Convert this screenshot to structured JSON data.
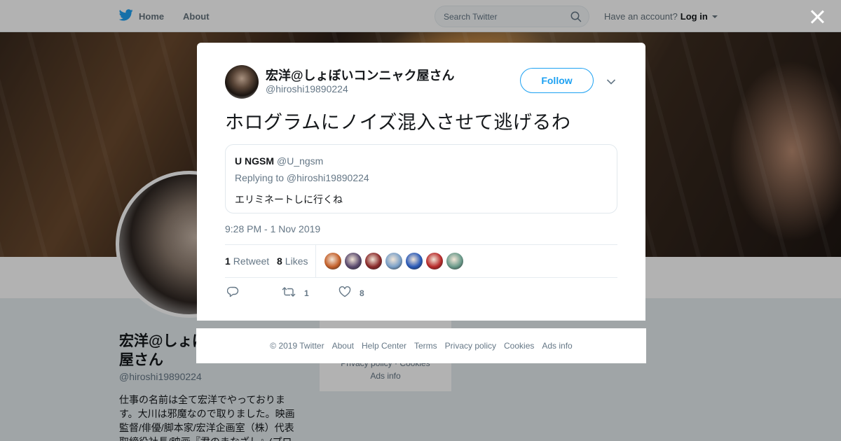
{
  "nav": {
    "home_label": "Home",
    "about_label": "About",
    "search_placeholder": "Search Twitter",
    "have_account": "Have an account?",
    "login_label": "Log in"
  },
  "profile": {
    "name": "宏洋@しょぼいコンニャク屋さん",
    "handle": "@hiroshi19890224",
    "bio": "仕事の名前は全て宏洋でやっております。大川は邪魔なので取りました。映画監督/俳優/脚本家/宏洋企画室（株）代表取締役社長/映画『君のまなざし』(プロ",
    "side_links": [
      "Privacy policy",
      "Cookies",
      "Ads info"
    ]
  },
  "tweet": {
    "author_name": "宏洋@しょぼいコンニャク屋さん",
    "author_handle": "@hiroshi19890224",
    "follow_label": "Follow",
    "text": "ホログラムにノイズ混入させて逃げるわ",
    "quote": {
      "name": "U NGSM",
      "handle": "@U_ngsm",
      "replying_to": "Replying to @hiroshi19890224",
      "text": "エリミネートしに行くね"
    },
    "timestamp": "9:28 PM - 1 Nov 2019",
    "retweet_count": "1",
    "retweet_label": "Retweet",
    "like_count": "8",
    "like_label": "Likes",
    "likers": [
      "#c4602a",
      "#5a4a6e",
      "#8a2a2a",
      "#7aa0c8",
      "#2a5ab8",
      "#b82a2a",
      "#6a9a8a"
    ],
    "action_retweet_count": "1",
    "action_like_count": "8"
  },
  "footer": {
    "links": [
      "© 2019 Twitter",
      "About",
      "Help Center",
      "Terms",
      "Privacy policy",
      "Cookies",
      "Ads info"
    ]
  },
  "colors": {
    "accent": "#1da1f2",
    "secondary_text": "#657786"
  }
}
